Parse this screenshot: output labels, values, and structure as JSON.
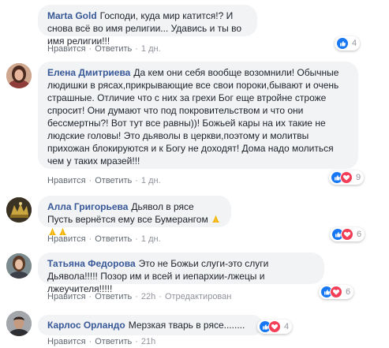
{
  "actions": {
    "like": "Нравится",
    "reply": "Ответить",
    "separator": "·"
  },
  "comments": [
    {
      "author": "Marta Gold",
      "text": "Господи, куда мир катится!? И снова всё во имя религии... Удавись и ты во имя религии!!!",
      "time": "1 дн.",
      "reactions": [
        "like"
      ],
      "reaction_count": "4",
      "edited": ""
    },
    {
      "author": "Елена Дмитриева",
      "text": "Да кем они себя вообще возомнили! Обычные людишки в рясах,прикрывающие все свои пороки,бывают и очень страшные. Отличие что с них за грехи Бог еще втройне строже спросит! Они думают что под покровительством и что они бессмертны?! Вот тут все равны))! Божьей кары на их такие не людские головы! Это дьяволы в церкви,поэтому и молитвы прихожан блокируются и к Богу не доходят! Дома надо молиться чем у таких мразей!!!",
      "time": "1 дн.",
      "reactions": [
        "like",
        "love"
      ],
      "reaction_count": "9",
      "edited": ""
    },
    {
      "author": "Алла Григорьева",
      "text": "Дьявол в рясе Пусть вернётся ему все Бумерангом",
      "emoji_count": 3,
      "time": "1 дн.",
      "reactions": [
        "like",
        "love"
      ],
      "reaction_count": "6",
      "edited": ""
    },
    {
      "author": "Татьяна Федорова",
      "text": "Это не Божьи слуги-это слуги Дьявола!!!!! Позор им и всей и иепархии-лжецы и лжеучителя!!!!!",
      "time": "22h",
      "reactions": [
        "like",
        "love"
      ],
      "reaction_count": "6",
      "edited": "Отредактирован"
    },
    {
      "author": "Карлос Орландо",
      "text": "Мерзкая тварь в рясе........",
      "time": "21h",
      "reactions": [
        "like",
        "love"
      ],
      "reaction_count": "4",
      "edited": ""
    }
  ],
  "colors": {
    "author": "#385898",
    "bubble": "#f2f3f5",
    "like": "#1877f2",
    "love": "#f33e58"
  }
}
